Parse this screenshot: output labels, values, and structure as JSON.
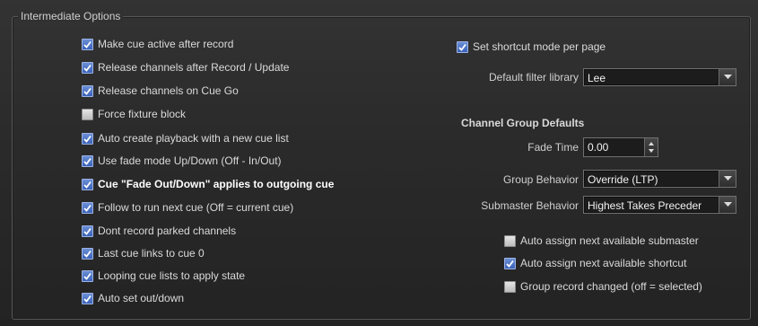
{
  "group": {
    "title": "Intermediate Options"
  },
  "left_options": [
    {
      "label": "Make cue active after record",
      "checked": true
    },
    {
      "label": "Release channels after Record / Update",
      "checked": true
    },
    {
      "label": "Release channels on Cue Go",
      "checked": true
    },
    {
      "label": "Force fixture block",
      "checked": false
    },
    {
      "label": "Auto create playback with a new cue list",
      "checked": true
    },
    {
      "label": "Use fade mode Up/Down (Off - In/Out)",
      "checked": true
    },
    {
      "label": "Cue \"Fade Out/Down\" applies to outgoing cue",
      "checked": true
    },
    {
      "label": "Follow to run next cue (Off = current cue)",
      "checked": true
    },
    {
      "label": "Dont record parked channels",
      "checked": true
    },
    {
      "label": "Last cue links to cue 0",
      "checked": true
    },
    {
      "label": "Looping cue lists to apply state",
      "checked": true
    },
    {
      "label": "Auto set out/down",
      "checked": true
    }
  ],
  "right": {
    "shortcut_mode": {
      "label": "Set shortcut mode per page",
      "checked": true
    },
    "filter_library": {
      "label": "Default filter library",
      "value": "Lee"
    },
    "channel_group_heading": "Channel Group Defaults",
    "fade_time": {
      "label": "Fade Time",
      "value": "0.00"
    },
    "group_behavior": {
      "label": "Group Behavior",
      "value": "Override (LTP)"
    },
    "submaster_behavior": {
      "label": "Submaster Behavior",
      "value": "Highest Takes Preceder"
    },
    "bottom_options": [
      {
        "label": "Auto assign next available submaster",
        "checked": false
      },
      {
        "label": "Auto assign next available shortcut",
        "checked": true
      },
      {
        "label": "Group record changed (off = selected)",
        "checked": false
      }
    ]
  },
  "icons": {
    "checkmark": "checkmark-icon",
    "dropdown": "chevron-down-icon",
    "spinner": "spin-arrows-icon"
  }
}
